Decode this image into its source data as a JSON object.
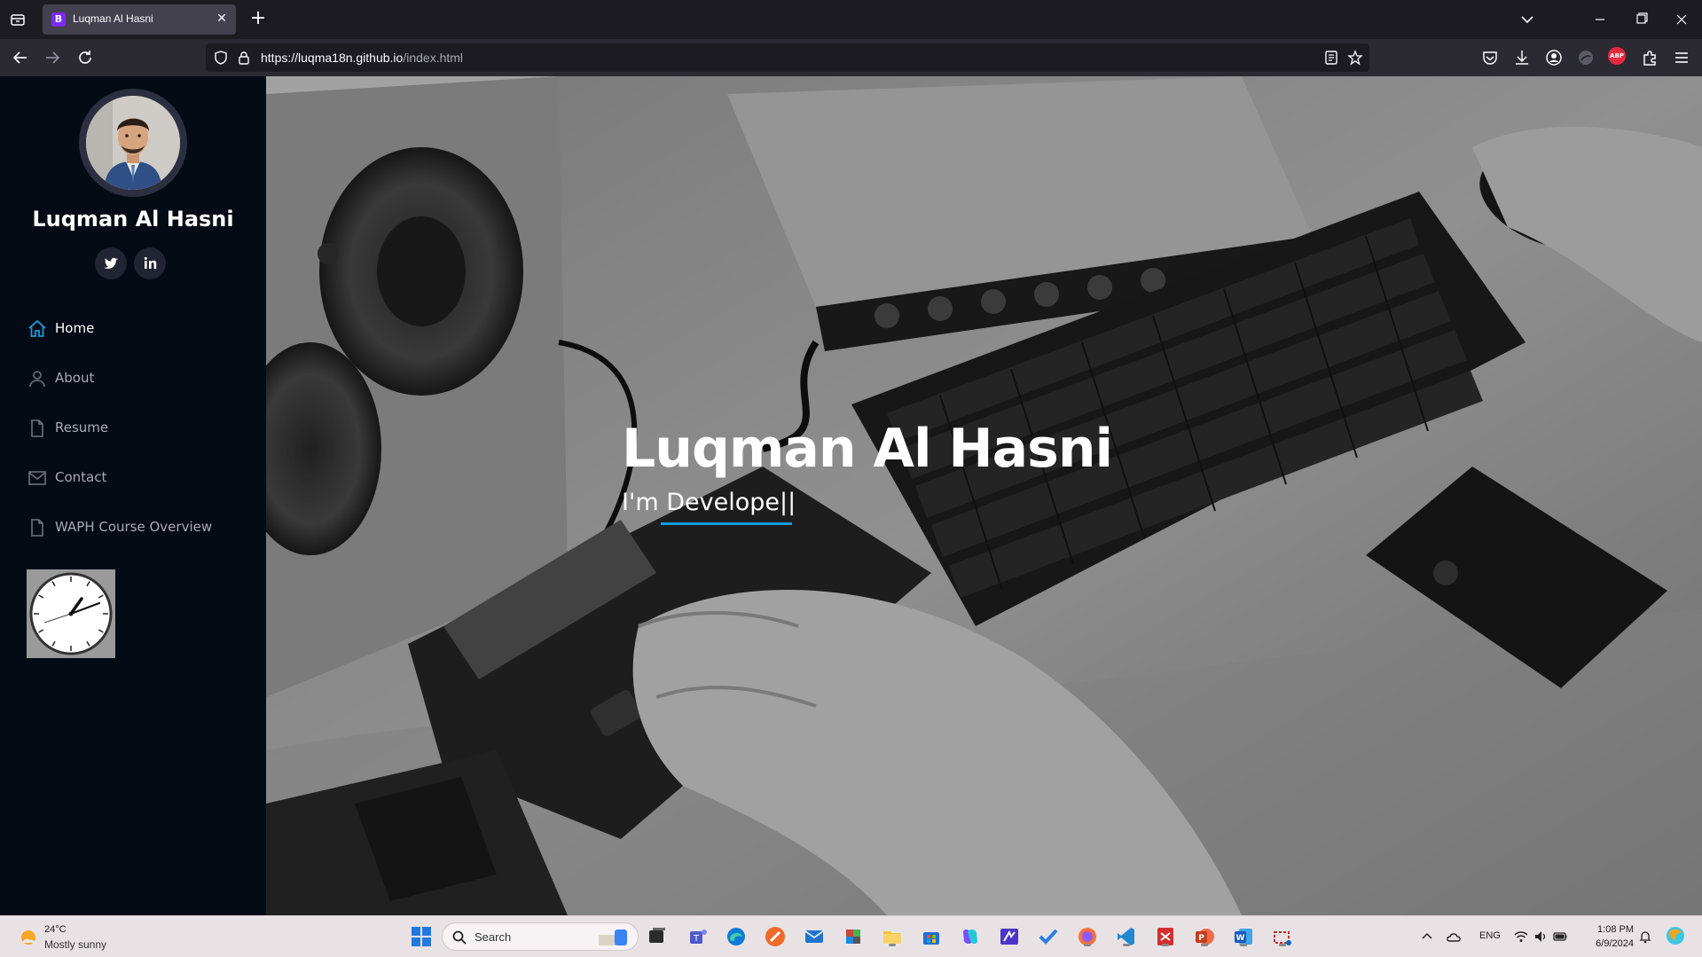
{
  "browser": {
    "tab_title": "Luqman Al Hasni",
    "tab_favicon": "B",
    "url_host": "https://luqma18n.github.io",
    "url_rest": "/index.html",
    "abp_label": "ABP"
  },
  "sidebar": {
    "name": "Luqman Al Hasni",
    "social": [
      "twitter-icon",
      "linkedin-icon"
    ],
    "items": [
      {
        "label": "Home",
        "icon": "home-icon",
        "active": true
      },
      {
        "label": "About",
        "icon": "person-icon",
        "active": false
      },
      {
        "label": "Resume",
        "icon": "file-icon",
        "active": false
      },
      {
        "label": "Contact",
        "icon": "envelope-icon",
        "active": false
      },
      {
        "label": "WAPH Course Overview",
        "icon": "file-icon",
        "active": false
      }
    ],
    "accent_color": "#149ddd"
  },
  "hero": {
    "title": "Luqman Al Hasni",
    "subtitle": "I'm Develope||"
  },
  "taskbar": {
    "temperature": "24°C",
    "condition": "Mostly sunny",
    "search_placeholder": "Search",
    "language": "ENG",
    "time": "1:08 PM",
    "date": "6/9/2024"
  }
}
